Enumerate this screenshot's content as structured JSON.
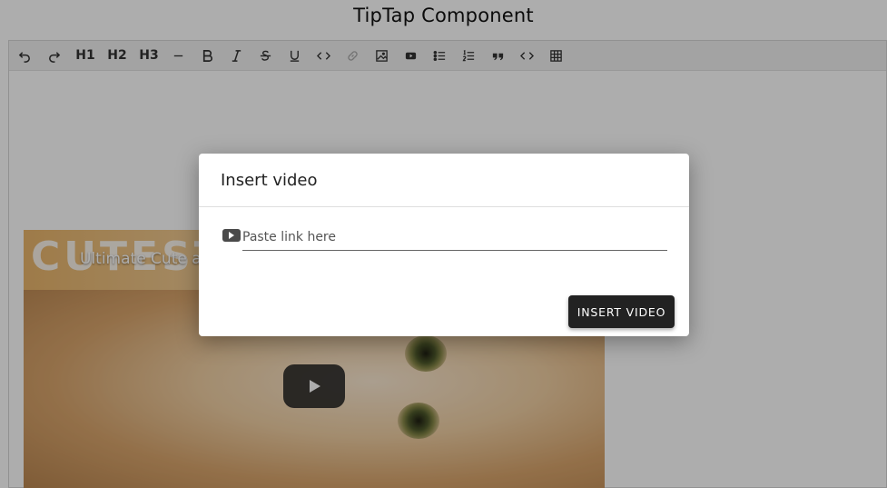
{
  "page": {
    "title": "TipTap Component"
  },
  "toolbar": {
    "buttons": [
      {
        "icon": "undo-icon"
      },
      {
        "icon": "redo-icon"
      },
      {
        "label": "H1"
      },
      {
        "label": "H2"
      },
      {
        "label": "H3"
      },
      {
        "icon": "horizontal-rule-icon"
      },
      {
        "icon": "bold-icon"
      },
      {
        "icon": "italic-icon"
      },
      {
        "icon": "strikethrough-icon"
      },
      {
        "icon": "underline-icon"
      },
      {
        "icon": "code-icon"
      },
      {
        "icon": "link-icon",
        "disabled": true
      },
      {
        "icon": "image-icon"
      },
      {
        "icon": "youtube-icon"
      },
      {
        "icon": "bullet-list-icon"
      },
      {
        "icon": "ordered-list-icon"
      },
      {
        "icon": "blockquote-icon"
      },
      {
        "icon": "code-block-icon"
      },
      {
        "icon": "table-icon"
      }
    ]
  },
  "video": {
    "channel_logo": "CUTEST",
    "title": "Ultimate Cute an"
  },
  "modal": {
    "title": "Insert video",
    "input": {
      "value": "",
      "placeholder": "Paste link here"
    },
    "submit_label": "INSERT VIDEO"
  },
  "colors": {
    "overlay": "#000000",
    "button": "#222222",
    "toolbar": "#f1f1f1"
  }
}
